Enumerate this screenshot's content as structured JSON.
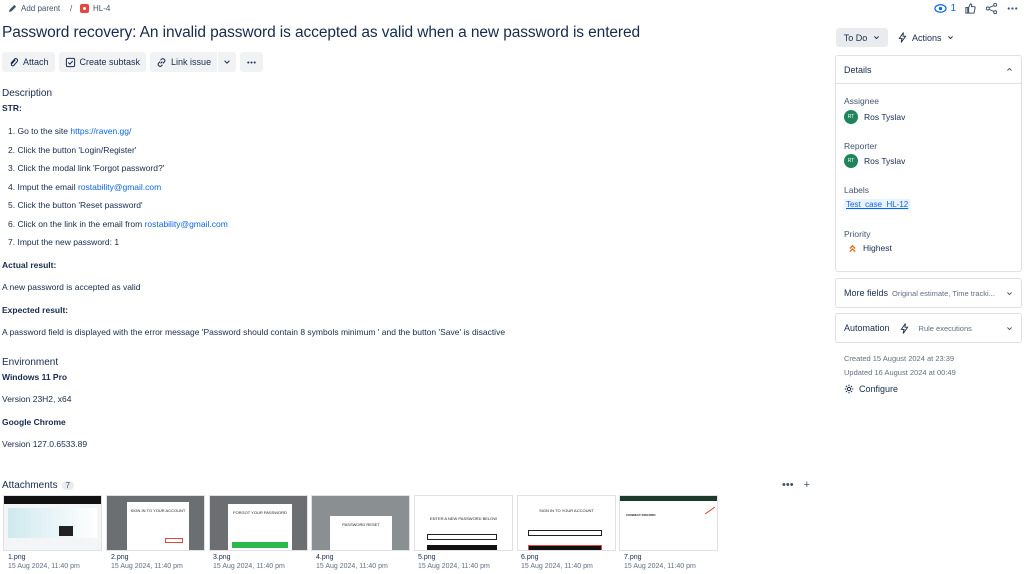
{
  "breadcrumb": {
    "add_parent": "Add parent",
    "separator": "/",
    "issue_key": "HL-4"
  },
  "header_actions": {
    "watchers_count": "1"
  },
  "issue": {
    "title": "Password recovery: An invalid password is accepted as valid when a new password is entered"
  },
  "toolbar": {
    "attach": "Attach",
    "create_subtask": "Create subtask",
    "link_issue": "Link issue"
  },
  "description": {
    "heading": "Description",
    "str_label": "STR:",
    "steps": [
      {
        "num": "1.",
        "text": "Go to the site ",
        "link": "https://raven.gg/"
      },
      {
        "num": "2.",
        "text": "Click the button 'Login/Register'",
        "link": ""
      },
      {
        "num": "3.",
        "text": "Click the modal link 'Forgot password?'",
        "link": ""
      },
      {
        "num": "4.",
        "text": "Imput the email ",
        "link": "rostability@gmail.com"
      },
      {
        "num": "5.",
        "text": "Click the button 'Reset password'",
        "link": ""
      },
      {
        "num": "6.",
        "text": "Click on the link in the email from ",
        "link": "rostability@gmail.com"
      },
      {
        "num": "7.",
        "text": "Imput the new password: 1",
        "link": ""
      }
    ],
    "actual_label": "Actual result:",
    "actual_text": "A new password is accepted as valid",
    "expected_label": "Expected result:",
    "expected_text": "A password field is displayed with the error message 'Password should contain 8 symbols minimum ' and the button 'Save' is disactive"
  },
  "environment": {
    "heading": "Environment",
    "os_label": "Windows 11 Pro",
    "os_version": "Version 23H2, x64",
    "browser_label": "Google Chrome",
    "browser_version": "Version 127.0.6533.89"
  },
  "attachments": {
    "heading": "Attachments",
    "count": "7",
    "files": [
      {
        "name": "1.png",
        "date": "15 Aug 2024, 11:40 pm",
        "preview": "homepage"
      },
      {
        "name": "2.png",
        "date": "15 Aug 2024, 11:40 pm",
        "preview": "SIGN IN TO YOUR ACCOUNT"
      },
      {
        "name": "3.png",
        "date": "15 Aug 2024, 11:40 pm",
        "preview": "FORGOT YOUR PASSWORD"
      },
      {
        "name": "4.png",
        "date": "15 Aug 2024, 11:40 pm",
        "preview": "PASSWORD RESET"
      },
      {
        "name": "5.png",
        "date": "15 Aug 2024, 11:40 pm",
        "preview": "ENTER A NEW PASSWORD BELOW"
      },
      {
        "name": "6.png",
        "date": "15 Aug 2024, 11:40 pm",
        "preview": "SIGN IN TO YOUR ACCOUNT"
      },
      {
        "name": "7.png",
        "date": "15 Aug 2024, 11:40 pm",
        "preview": "CONNECT DISCORD"
      }
    ]
  },
  "sidebar": {
    "status": "To Do",
    "actions": "Actions",
    "details_heading": "Details",
    "assignee_label": "Assignee",
    "assignee": "Ros Tyslav",
    "assignee_initials": "RT",
    "reporter_label": "Reporter",
    "reporter": "Ros Tyslav",
    "reporter_initials": "RT",
    "labels_label": "Labels",
    "label_value": "Test_case_HL-12",
    "priority_label": "Priority",
    "priority": "Highest",
    "more_fields": "More fields",
    "more_fields_sub": "Original estimate, Time tracki...",
    "automation": "Automation",
    "automation_sub": "Rule executions",
    "created": "Created 15 August 2024 at 23:39",
    "updated": "Updated 16 August 2024 at 00:49",
    "configure": "Configure"
  },
  "colors": {
    "accent": "#0c66e4",
    "priority": "#e56910",
    "bug": "#e2483d",
    "avatar": "#1f845a"
  }
}
